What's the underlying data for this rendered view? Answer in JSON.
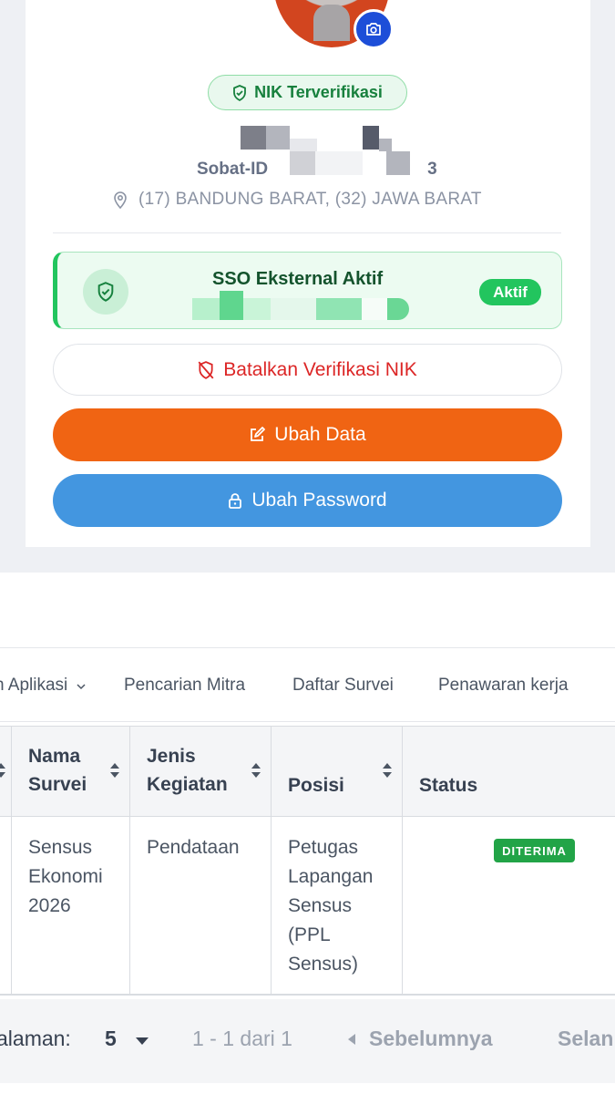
{
  "profile": {
    "nik_badge": "NIK Terverifikasi",
    "sobat_id": "Sobat-ID",
    "sobat_suffix": "3",
    "location": "(17) BANDUNG BARAT, (32) JAWA BARAT",
    "sso_title": "SSO Eksternal Aktif",
    "sso_status": "Aktif",
    "btn_batal": "Batalkan Verifikasi NIK",
    "btn_ubah_data": "Ubah Data",
    "btn_ubah_password": "Ubah Password"
  },
  "nav": {
    "items": [
      "n Aplikasi",
      "Pencarian Mitra",
      "Daftar Survei",
      "Penawaran kerja"
    ]
  },
  "table": {
    "headers": [
      "Nama Survei",
      "Jenis Kegiatan",
      "Posisi",
      "Status"
    ],
    "header_lines": [
      [
        "Nama",
        "Survei"
      ],
      [
        "Jenis",
        "Kegiatan"
      ],
      [
        "Posisi"
      ],
      [
        "Status"
      ]
    ],
    "row": {
      "nama_lines": [
        "Sensus",
        "Ekonomi",
        "2026"
      ],
      "jenis": "Pendataan",
      "posisi_lines": [
        "Petugas",
        "Lapangan",
        "Sensus",
        "(PPL",
        "Sensus)"
      ],
      "status": "DITERIMA"
    }
  },
  "pager": {
    "per_page_label": "alaman:",
    "per_page_value": "5",
    "range": "1 - 1 dari 1",
    "prev": "Sebelumnya",
    "next": "Selan"
  },
  "colors": {
    "orange": "#f06413",
    "blue": "#4396e0",
    "green": "#22c55e",
    "red": "#dc2626"
  }
}
